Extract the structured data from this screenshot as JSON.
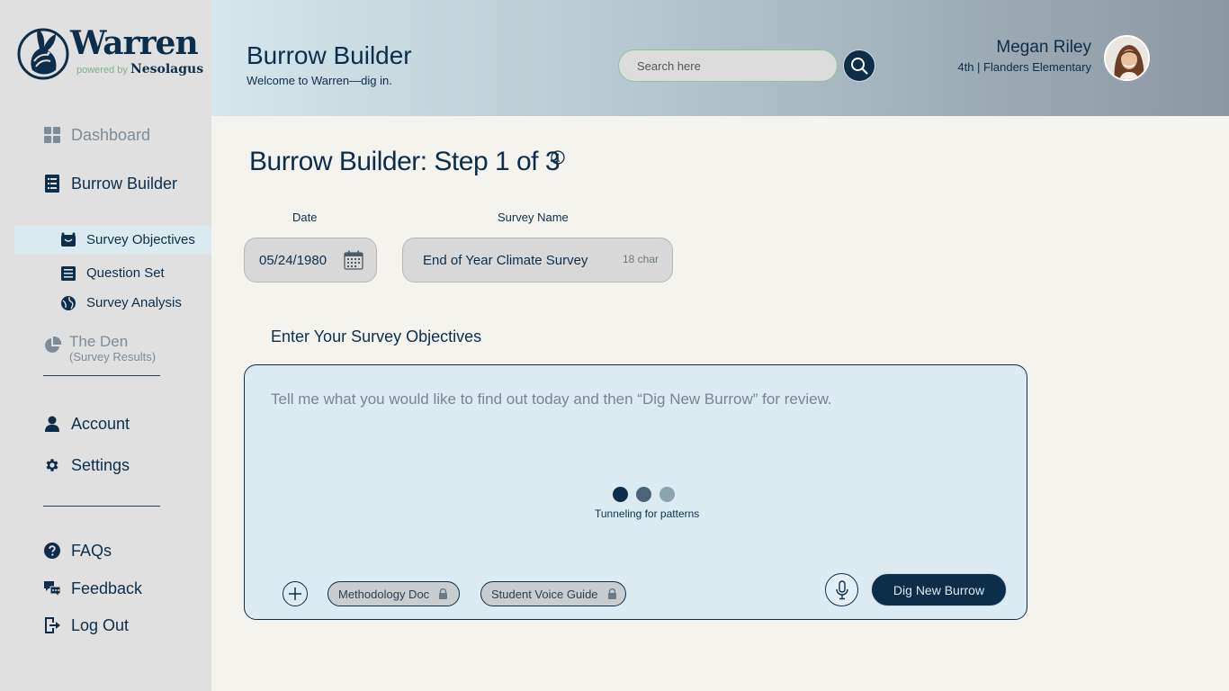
{
  "brand": {
    "name": "Warren",
    "powered_prefix": "powered by",
    "powered_company": "Nesolagus"
  },
  "sidebar": {
    "dashboard": "Dashboard",
    "burrow_builder": "Burrow Builder",
    "sub_items": [
      {
        "label": "Survey Objectives",
        "active": true
      },
      {
        "label": "Question Set",
        "active": false
      },
      {
        "label": "Survey Analysis",
        "active": false
      }
    ],
    "den_title": "The Den",
    "den_sub": "(Survey Results)",
    "account": "Account",
    "settings": "Settings",
    "faqs": "FAQs",
    "feedback": "Feedback",
    "logout": "Log Out"
  },
  "header": {
    "title": "Burrow Builder",
    "subtitle": "Welcome to Warren—dig in.",
    "search_placeholder": "Search here",
    "user_name": "Megan Riley",
    "user_role": "4th | Flanders Elementary"
  },
  "main": {
    "page_title": "Burrow Builder: Step 1 of 3",
    "date_label": "Date",
    "date_value": "05/24/1980",
    "survey_name_label": "Survey Name",
    "survey_name_value": "End of Year Climate Survey",
    "survey_name_count": "18 char",
    "objectives_label": "Enter Your Survey Objectives",
    "objectives_placeholder": "Tell me what you would like to find out today and then “Dig New Burrow” for review.",
    "loading_text": "Tunneling for patterns",
    "chips": [
      "Methodology Doc",
      "Student Voice Guide"
    ],
    "submit_label": "Dig New Burrow"
  },
  "colors": {
    "navy": "#0d2e4b",
    "sidebar_bg": "#e0e0e0",
    "page_bg": "#f5f3ee",
    "objectives_bg": "#dbebf1",
    "active_sub_bg": "#daeaf0",
    "dot_1": "#0d2e4b",
    "dot_2": "#4a6578",
    "dot_3": "#8ca3b0"
  }
}
